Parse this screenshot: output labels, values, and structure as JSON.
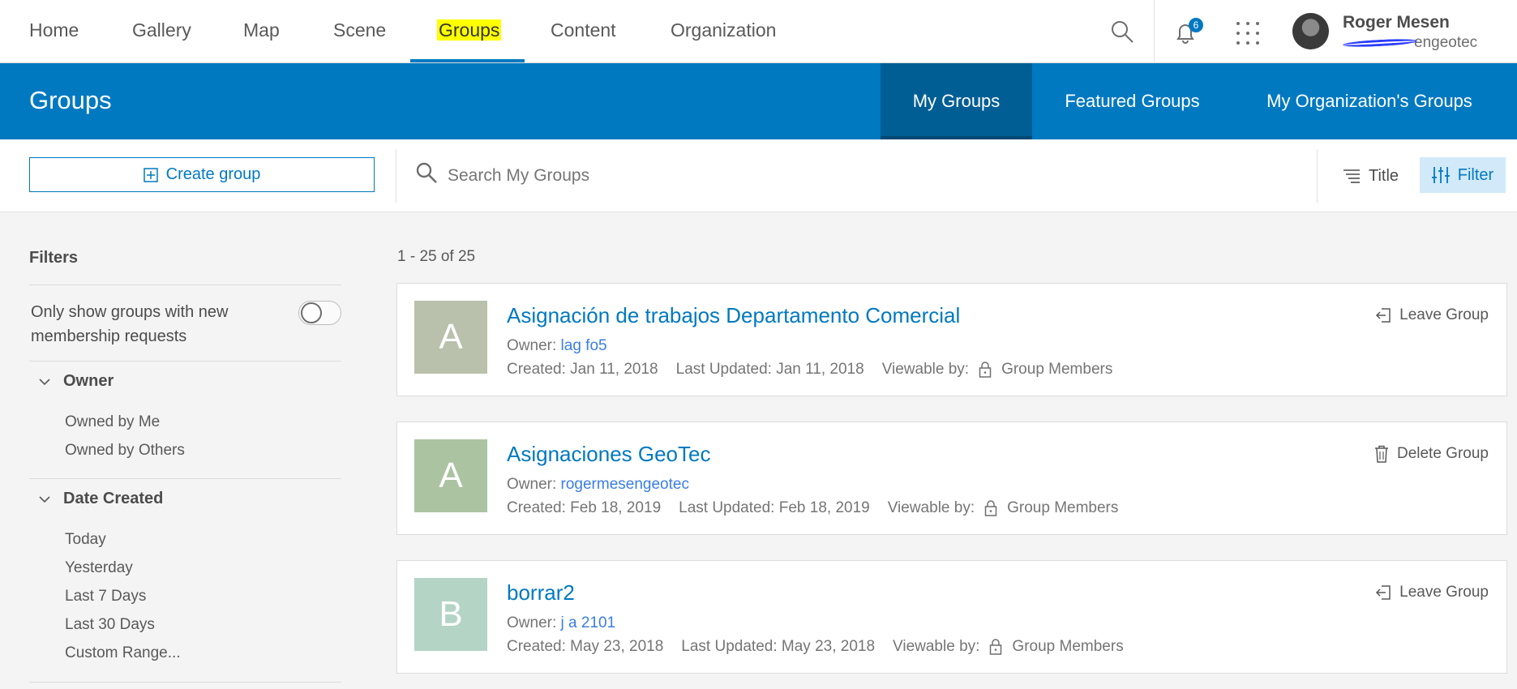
{
  "nav": {
    "items": [
      "Home",
      "Gallery",
      "Map",
      "Scene",
      "Groups",
      "Content",
      "Organization"
    ],
    "active_index": 4,
    "notifications_count": "6",
    "user_name": "Roger Mesen",
    "user_handle": "engeotec"
  },
  "header": {
    "title": "Groups",
    "tabs": [
      "My Groups",
      "Featured Groups",
      "My Organization's Groups"
    ],
    "active_tab": "My Groups"
  },
  "toolbar": {
    "create_label": "Create group",
    "search_placeholder": "Search My Groups",
    "sort_label": "Title",
    "filter_label": "Filter"
  },
  "sidebar": {
    "title": "Filters",
    "toggle_label": "Only show groups with new membership requests",
    "toggle_on": false,
    "sections": [
      {
        "title": "Owner",
        "items": [
          "Owned by Me",
          "Owned by Others"
        ]
      },
      {
        "title": "Date Created",
        "items": [
          "Today",
          "Yesterday",
          "Last 7 Days",
          "Last 30 Days",
          "Custom Range..."
        ]
      }
    ]
  },
  "results": {
    "count_label": "1 - 25 of 25",
    "labels": {
      "owner": "Owner:",
      "created": "Created:",
      "updated": "Last Updated:",
      "viewable": "Viewable by:"
    },
    "groups": [
      {
        "letter": "A",
        "color": "#b9c0ab",
        "title": "Asignación de trabajos Departamento Comercial",
        "owner": "lag fo5",
        "created": "Jan 11, 2018",
        "updated": "Jan 11, 2018",
        "viewable": "Group Members",
        "action": "Leave Group",
        "action_icon": "leave-icon"
      },
      {
        "letter": "A",
        "color": "#abc3a1",
        "title": "Asignaciones GeoTec",
        "owner": "rogermesengeotec",
        "created": "Feb 18, 2019",
        "updated": "Feb 18, 2019",
        "viewable": "Group Members",
        "action": "Delete Group",
        "action_icon": "trash-icon"
      },
      {
        "letter": "B",
        "color": "#b4d4c6",
        "title": "borrar2",
        "owner": "j   a   2101",
        "created": "May 23, 2018",
        "updated": "May 23, 2018",
        "viewable": "Group Members",
        "action": "Leave Group",
        "action_icon": "leave-icon"
      }
    ]
  }
}
